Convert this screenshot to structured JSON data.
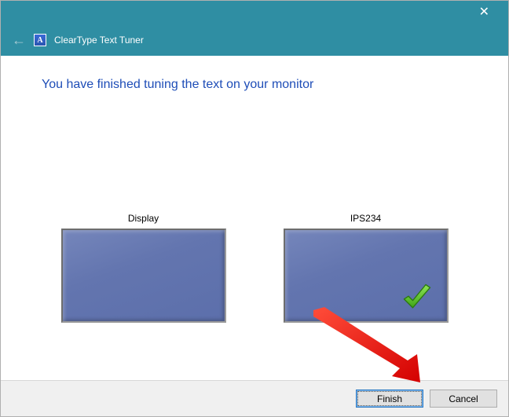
{
  "window": {
    "title": "ClearType Text Tuner",
    "app_icon_glyph": "A"
  },
  "heading": "You have finished tuning the text on your monitor",
  "monitors": [
    {
      "label": "Display",
      "checked": false
    },
    {
      "label": "IPS234",
      "checked": true
    }
  ],
  "buttons": {
    "finish": "Finish",
    "cancel": "Cancel"
  }
}
